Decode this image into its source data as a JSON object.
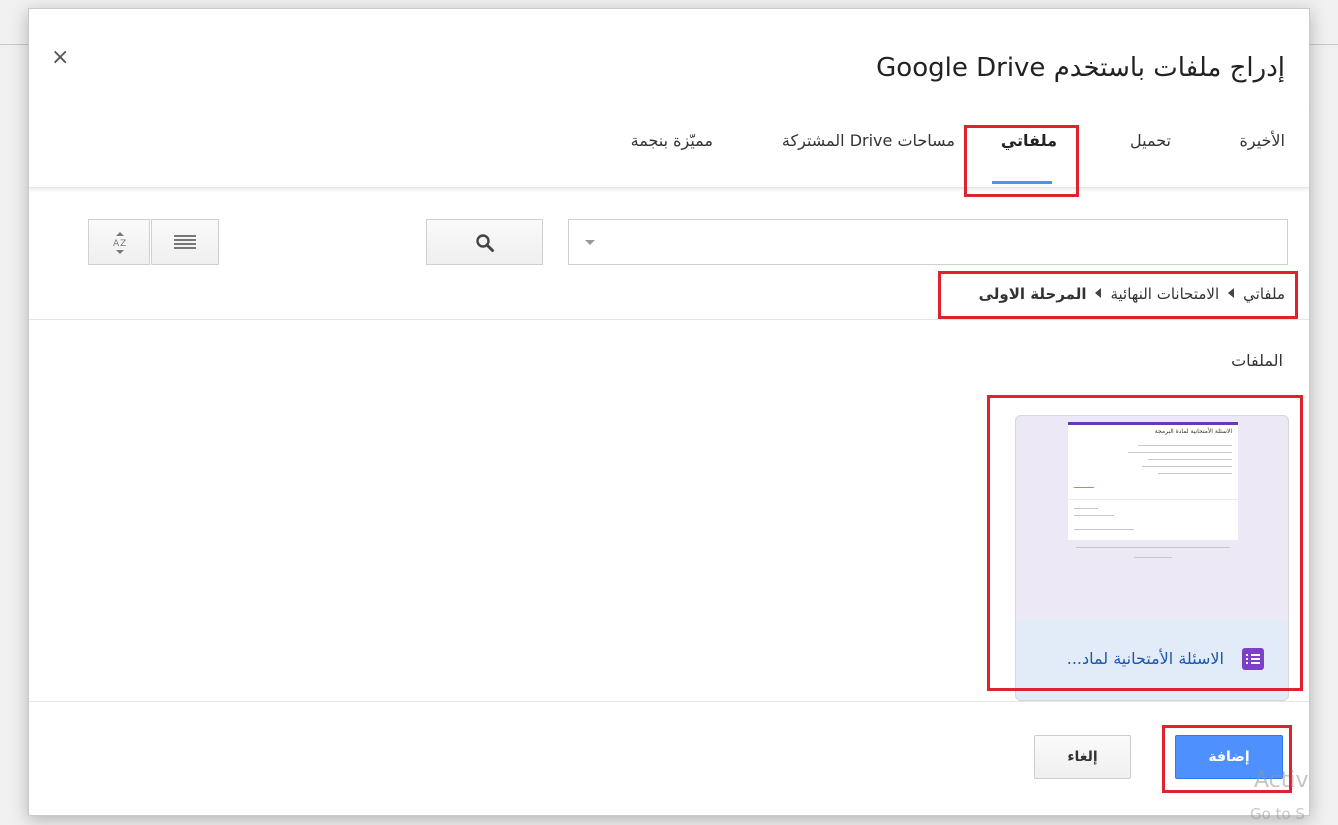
{
  "dialog": {
    "title": "إدراج ملفات باستخدم Google Drive",
    "close_glyph": "×"
  },
  "tabs": [
    {
      "label": "الأخيرة",
      "active": false
    },
    {
      "label": "تحميل",
      "active": false
    },
    {
      "label": "ملفاتي",
      "active": true
    },
    {
      "label": "مساحات Drive المشتركة",
      "active": false
    },
    {
      "label": "مميّزة بنجمة",
      "active": false
    }
  ],
  "search": {
    "value": "",
    "placeholder": ""
  },
  "icons": {
    "search": "search-icon",
    "sort": "sort-az-icon",
    "list_view": "list-view-icon",
    "file_type": "google-forms-icon",
    "dropdown": "chevron-down-icon"
  },
  "breadcrumb": {
    "items": [
      "ملفاتي",
      "الامتحانات النهائية",
      "المرحلة الاولى"
    ]
  },
  "files": {
    "section_label": "الملفات",
    "items": [
      {
        "name": "الاسئلة الأمتحانية لماد...",
        "thumb_title": "الاسئلة الأمتحانية لمادة البرمجة"
      }
    ]
  },
  "actions": {
    "add_label": "إضافة",
    "cancel_label": "إلغاء"
  },
  "watermark": {
    "line1": "Activ",
    "line2": "Go to S"
  },
  "colors": {
    "accent": "#4d90fe",
    "highlight": "#e0212e",
    "forms_purple": "#7e3fc7"
  }
}
